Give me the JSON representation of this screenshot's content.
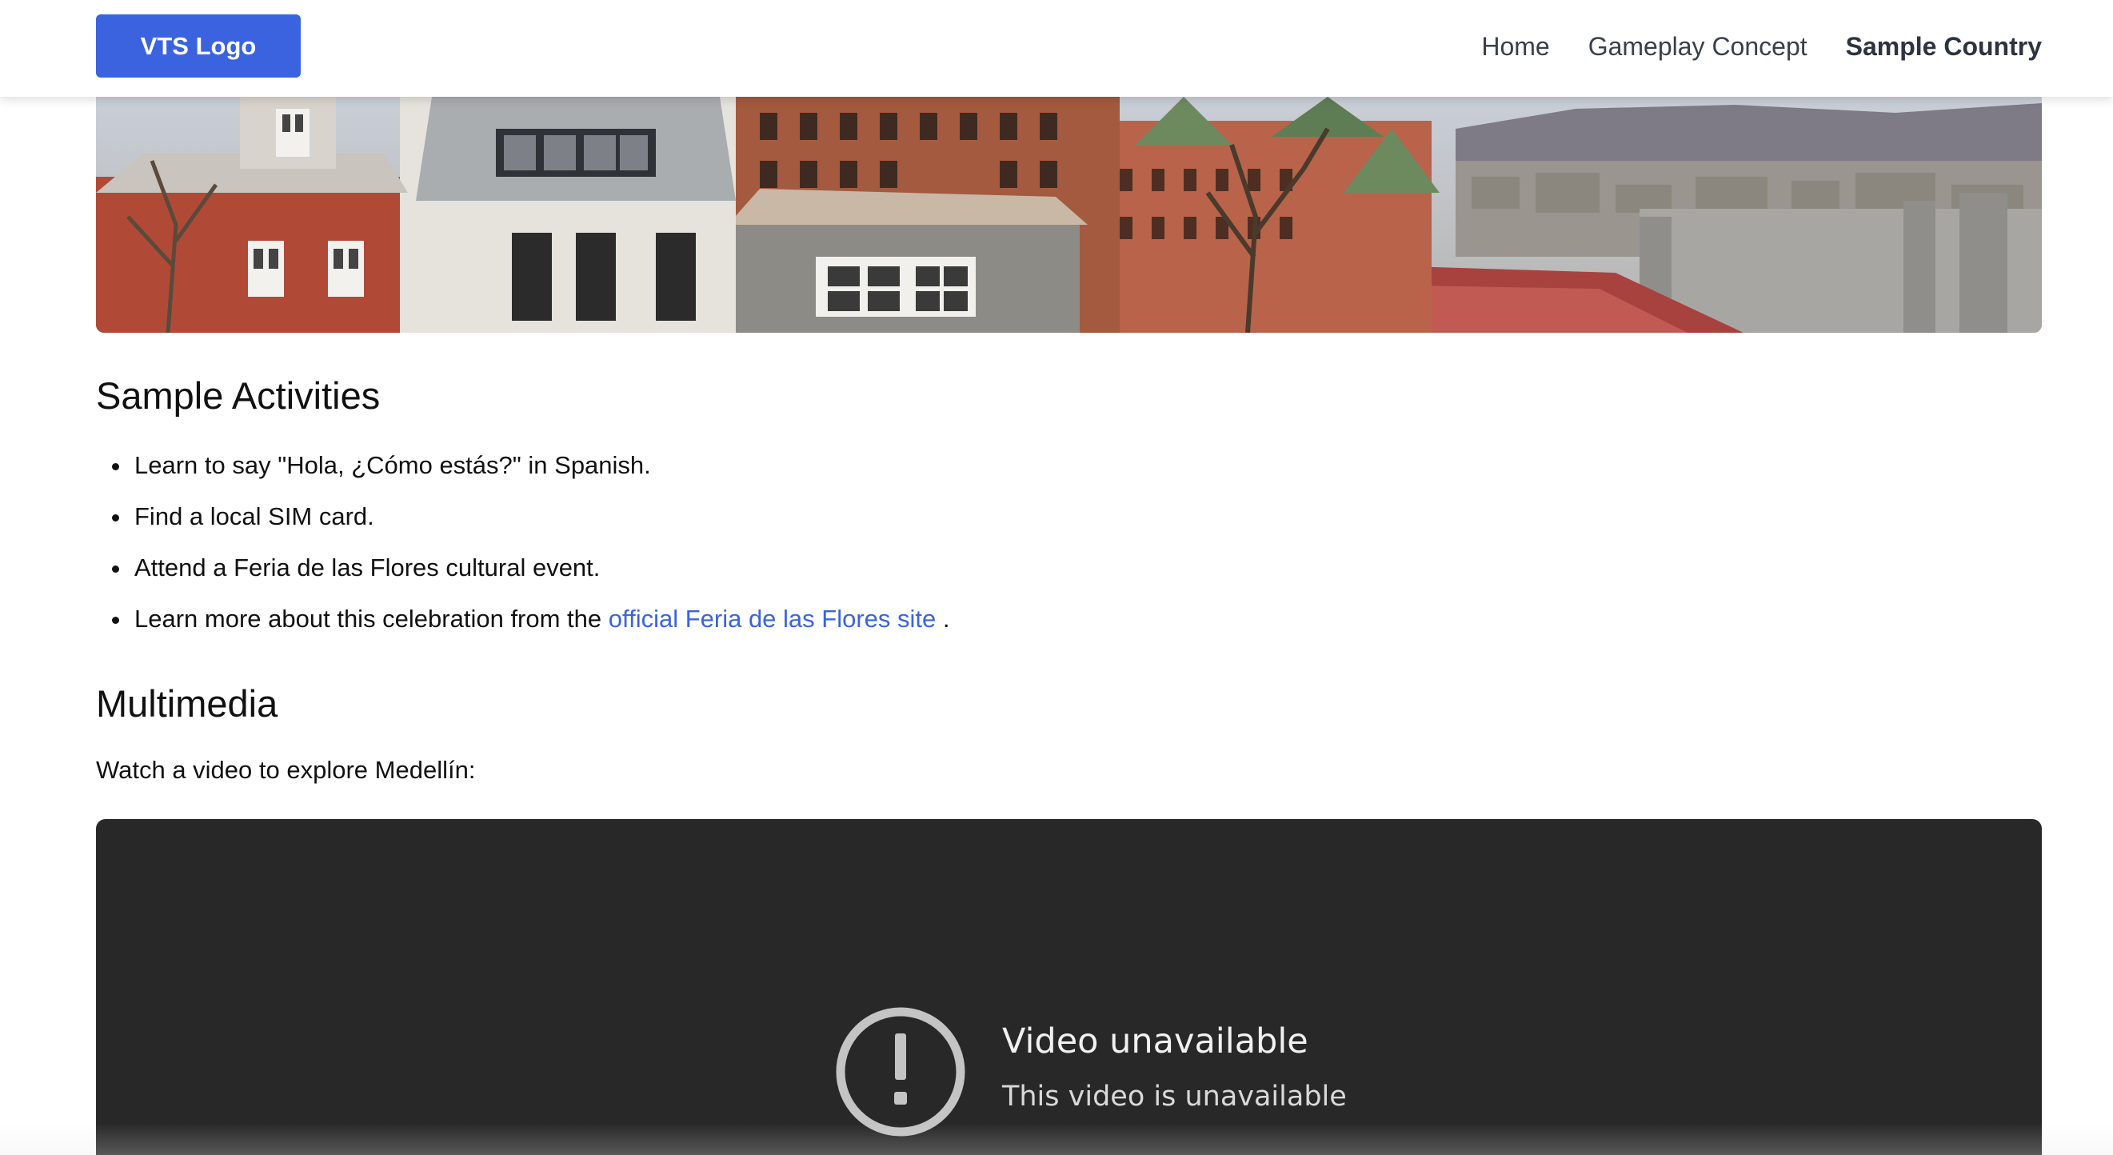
{
  "header": {
    "logo_label": "VTS Logo",
    "nav": [
      {
        "label": "Home",
        "active": false
      },
      {
        "label": "Gameplay Concept",
        "active": false
      },
      {
        "label": "Sample Country",
        "active": true
      }
    ]
  },
  "hero": {
    "image": "city-rooftops-panorama"
  },
  "activities": {
    "heading": "Sample Activities",
    "items": [
      "Learn to say \"Hola, ¿Cómo estás?\" in Spanish.",
      "Find a local SIM card.",
      "Attend a Feria de las Flores cultural event."
    ],
    "link_item": {
      "prefix": "Learn more about this celebration from the ",
      "link_text": "official Feria de las Flores site",
      "suffix": " ."
    }
  },
  "multimedia": {
    "heading": "Multimedia",
    "intro": "Watch a video to explore Medellín:",
    "video": {
      "title": "Video unavailable",
      "subtitle": "This video is unavailable",
      "icon": "exclamation-circle-icon"
    }
  },
  "colors": {
    "accent": "#3b63e0",
    "video_bg": "#282828"
  }
}
